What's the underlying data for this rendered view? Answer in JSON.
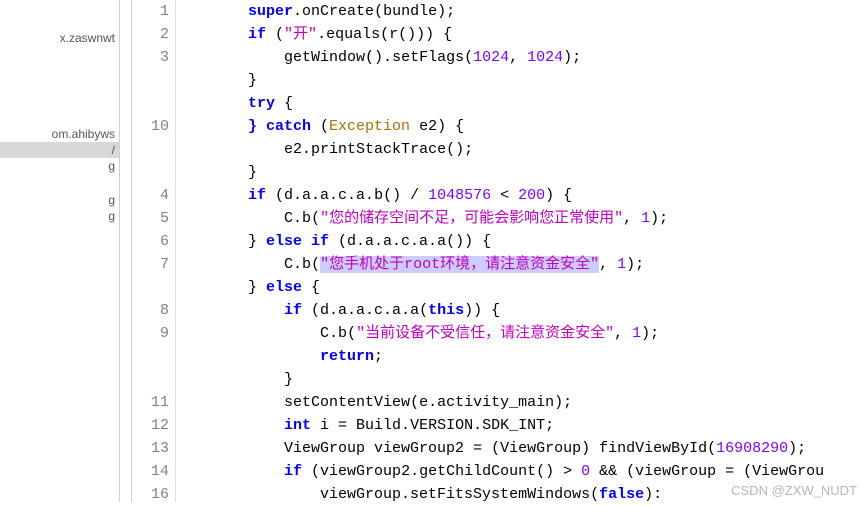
{
  "sidebar": {
    "items": [
      {
        "label": "x.zaswnwt",
        "selected": false
      },
      {
        "label": "om.ahibyws",
        "selected": false
      },
      {
        "label": "/",
        "selected": true
      },
      {
        "label": "g",
        "selected": false
      },
      {
        "label": "g",
        "selected": false
      },
      {
        "label": "g",
        "selected": false
      }
    ]
  },
  "gutter": {
    "lines": [
      "1",
      "2",
      "3",
      "",
      "",
      "10",
      "",
      "",
      "4",
      "5",
      "6",
      "7",
      "",
      "8",
      "9",
      "",
      "",
      "11",
      "12",
      "13",
      "14",
      "16"
    ]
  },
  "code": {
    "l1": {
      "indent": "        ",
      "kw": "super",
      "dot": ".",
      "m": "onCreate",
      "arg": "bundle",
      "tail": ");"
    },
    "l2": {
      "indent": "        ",
      "kw": "if",
      "open": " (",
      "s1": "\"开\"",
      "dot": ".",
      "m": "equals",
      "call": "(r())) {"
    },
    "l3": {
      "indent": "            ",
      "m1": "getWindow",
      "p1": "().",
      "m2": "setFlags",
      "p2": "(",
      "n1": "1024",
      "c": ", ",
      "n2": "1024",
      "tail": ");"
    },
    "l4": {
      "indent": "        ",
      "brace": "}"
    },
    "l5": {
      "indent": "        ",
      "kw": "try",
      "tail": " {"
    },
    "l6": {
      "indent": "        ",
      "kw": "} catch",
      "open": " (",
      "type": "Exception",
      "var": " e2",
      "tail": ") {"
    },
    "l7": {
      "indent": "            ",
      "obj": "e2.",
      "m": "printStackTrace",
      "tail": "();"
    },
    "l8": {
      "indent": "        ",
      "brace": "}"
    },
    "l9": {
      "indent": "        ",
      "kw": "if",
      "open": " (d.a.a.c.a.",
      "m": "b",
      "mid": "() / ",
      "n1": "1048576",
      "lt": " < ",
      "n2": "200",
      "tail": ") {"
    },
    "l10": {
      "indent": "            ",
      "obj": "C.",
      "m": "b",
      "p": "(",
      "s": "\"您的储存空间不足，可能会影响您正常使用\"",
      "c": ", ",
      "n": "1",
      "tail": ");"
    },
    "l11": {
      "indent": "        } ",
      "kw": "else if",
      "open": " (d.a.a.c.a.",
      "m": "a",
      "tail": "()) {"
    },
    "l12": {
      "indent": "            ",
      "obj": "C.",
      "m": "b",
      "p": "(",
      "s": "\"您手机处于root环境，请注意资金安全\"",
      "c": ", ",
      "n": "1",
      "tail": ");"
    },
    "l13": {
      "indent": "        } ",
      "kw": "else",
      "tail": " {"
    },
    "l14": {
      "indent": "            ",
      "kw": "if",
      "open": " (d.a.a.c.a.",
      "m": "a",
      "p": "(",
      "kw2": "this",
      "tail": ")) {"
    },
    "l15": {
      "indent": "                ",
      "obj": "C.",
      "m": "b",
      "p": "(",
      "s": "\"当前设备不受信任，请注意资金安全\"",
      "c": ", ",
      "n": "1",
      "tail": ");"
    },
    "l16": {
      "indent": "                ",
      "kw": "return",
      "tail": ";"
    },
    "l17": {
      "indent": "            ",
      "brace": "}"
    },
    "l18": {
      "indent": "            ",
      "m": "setContentView",
      "arg": "(e.activity_main);"
    },
    "l19": {
      "indent": "            ",
      "kw": "int",
      "var": " i = Build.VERSION.SDK_INT;"
    },
    "l20": {
      "indent": "            ",
      "type": "ViewGroup",
      "var": " viewGroup2 = (",
      "type2": "ViewGroup",
      "mid": ") ",
      "m": "findViewById",
      "p": "(",
      "n": "16908290",
      "tail": ");"
    },
    "l21": {
      "indent": "            ",
      "kw": "if",
      "open": " (viewGroup2.",
      "m": "getChildCount",
      "mid": "() > ",
      "n": "0",
      "and": " && (viewGroup = (ViewGrou"
    },
    "l22": {
      "indent": "                ",
      "obj": "viewGroup.",
      "m": "setFitsSystemWindows",
      "p": "(",
      "kw": "false",
      "tail": "):"
    }
  },
  "watermark": "CSDN @ZXW_NUDT"
}
